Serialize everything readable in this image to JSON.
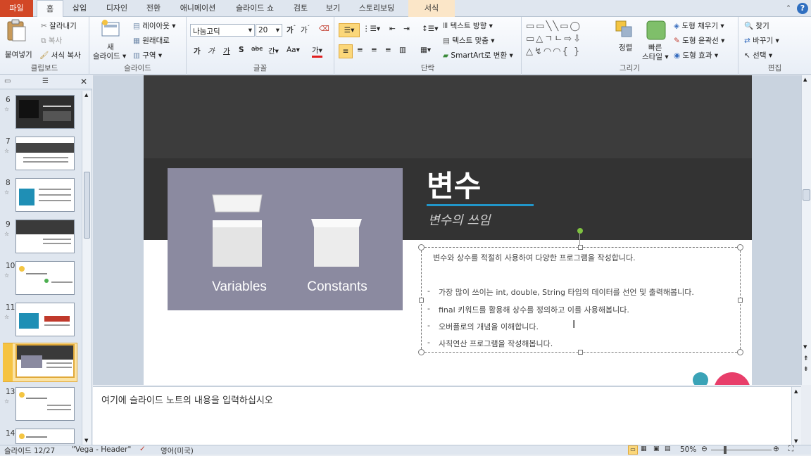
{
  "tabs": {
    "file": "파일",
    "home": "홈",
    "insert": "삽입",
    "design": "디자인",
    "transitions": "전환",
    "animations": "애니메이션",
    "slideshow": "슬라이드 쇼",
    "review": "검토",
    "view": "보기",
    "storyboarding": "스토리보딩",
    "format": "서식"
  },
  "ribbon": {
    "clipboard": {
      "paste": "붙여넣기",
      "cut": "잘라내기",
      "copy": "복사",
      "format_painter": "서식 복사",
      "label": "클립보드"
    },
    "slides": {
      "new_slide": "새",
      "new_slide2": "슬라이드",
      "layout": "레이아웃",
      "reset": "원래대로",
      "section": "구역",
      "label": "슬라이드"
    },
    "font": {
      "name": "나눔고딕",
      "size": "20",
      "label": "글꼴",
      "bold": "가",
      "italic": "가",
      "underline": "가",
      "strike": "S",
      "shadow": "abc",
      "spacing": "간",
      "case": "Aa",
      "color": "가"
    },
    "paragraph": {
      "text_direction": "텍스트 방향",
      "align_text": "텍스트 맞춤",
      "smartart": "SmartArt로 변환",
      "label": "단락"
    },
    "drawing": {
      "arrange": "정렬",
      "quick_styles": "빠른",
      "quick_styles2": "스타일",
      "fill": "도형 채우기",
      "outline": "도형 윤곽선",
      "effects": "도형 효과",
      "label": "그리기"
    },
    "editing": {
      "find": "찾기",
      "replace": "바꾸기",
      "select": "선택",
      "label": "편집"
    }
  },
  "thumbnails": [
    {
      "num": "6"
    },
    {
      "num": "7"
    },
    {
      "num": "8"
    },
    {
      "num": "9"
    },
    {
      "num": "10"
    },
    {
      "num": "11"
    },
    {
      "num": "12"
    },
    {
      "num": "13"
    },
    {
      "num": "14"
    }
  ],
  "slide": {
    "title": "변수",
    "subtitle": "변수의 쓰임",
    "image_label_left": "Variables",
    "image_label_right": "Constants",
    "intro": "변수와 상수를 적절히 사용하여 다양한 프로그램을 작성합니다.",
    "bullets": [
      "가장 많이 쓰이는 int, double, String 타입의 데이터를 선언 및 출력해봅니다.",
      "final 키워드를 활용해 상수를 정의하고 이를 사용해봅니다.",
      "오버플로의 개념을 이해합니다.",
      "사칙연산 프로그램을 작성해봅니다."
    ],
    "bullet_marker": "-"
  },
  "notes": {
    "placeholder": "여기에 슬라이드 노트의 내용을 입력하십시오"
  },
  "status": {
    "slide_pos": "슬라이드 12/27",
    "theme": "\"Vega - Header\"",
    "language": "영어(미국)",
    "zoom": "50%"
  },
  "colors": {
    "accent": "#2196c9",
    "file_tab": "#d24726",
    "header_dark": "#3a3a3a",
    "image_bg": "#8a8aa0",
    "pink": "#e83e6a",
    "teal": "#3aa3b7"
  }
}
